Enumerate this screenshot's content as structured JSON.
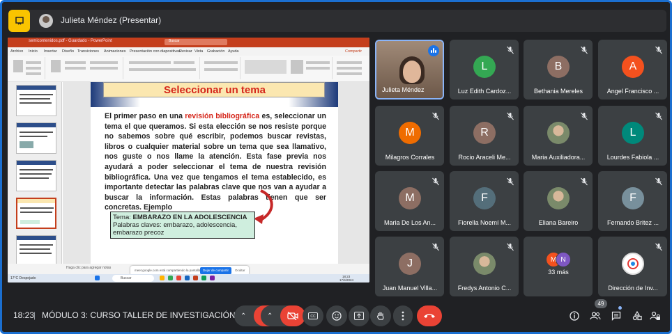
{
  "presenter": {
    "name": "Julieta Méndez (Presentar)"
  },
  "slide": {
    "title": "Seleccionar un tema",
    "body_pre": "El primer paso en una ",
    "body_highlight": "revisión bibliográfica",
    "body_post": " es, seleccionar un tema el que queramos. Si esta elección se nos resiste porque no sabemos sobre qué escribir, podemos buscar revistas, libros o cualquier material sobre un tema que sea llamativo, nos guste o nos llame la atención. Esta fase previa nos ayudará a poder seleccionar el tema de nuestra revisión bibliográfica. Una vez que tengamos el tema establecido, es importante detectar las palabras clave que nos van a ayudar a buscar la información. Estas palabras tienen que ser concretas. Ejemplo",
    "tema_label": "Tema: ",
    "tema_value": "EMBARAZO EN LA ADOLESCENCIA",
    "claves": "Palabras claves: embarazo, adolescencia, embarazo precoz"
  },
  "ppt": {
    "title_text": "semicontenidos.pdf - Guardado - PowerPoint",
    "search": "Buscar",
    "tabs": [
      "Archivo",
      "Inicio",
      "Insertar",
      "Diseño",
      "Transiciones",
      "Animaciones",
      "Presentación con diapositivas",
      "Revisar",
      "Vista",
      "Grabación",
      "Ayuda"
    ],
    "share": "Compartir",
    "notes_hint": "Haga clic para agregar notas",
    "share_msg": "meet.google.com está compartiendo la pantalla.",
    "stop_share": "Dejar de compartir",
    "hide": "Ocultar",
    "taskbar_search": "Buscar",
    "weather": "17°C Despejado",
    "time": "18:23",
    "date": "17/4/2024"
  },
  "participants": [
    {
      "name": "Julieta Méndez",
      "type": "video",
      "speaking": true
    },
    {
      "name": "Luz Edith Cardoz...",
      "initial": "L",
      "color": "#34a853",
      "muted": true
    },
    {
      "name": "Bethania Mereles",
      "initial": "B",
      "color": "#8d6e63",
      "muted": true
    },
    {
      "name": "Angel Francisco ...",
      "initial": "A",
      "color": "#f4511e",
      "muted": true
    },
    {
      "name": "Milagros Corrales",
      "initial": "M",
      "color": "#ef6c00",
      "muted": true
    },
    {
      "name": "Rocio Araceli Me...",
      "initial": "R",
      "color": "#8d6e63",
      "muted": true
    },
    {
      "name": "Maria Auxiliadora...",
      "type": "photo",
      "muted": true
    },
    {
      "name": "Lourdes Fabiola ...",
      "initial": "L",
      "color": "#00897b",
      "muted": true
    },
    {
      "name": "Maria De Los An...",
      "initial": "M",
      "color": "#8d6e63",
      "muted": true
    },
    {
      "name": "Fiorella Noemí M...",
      "initial": "F",
      "color": "#546e7a",
      "muted": true
    },
    {
      "name": "Eliana Bareiro",
      "type": "photo",
      "muted": true
    },
    {
      "name": "Fernando Britez ...",
      "initial": "F",
      "color": "#78909c",
      "muted": true
    },
    {
      "name": "Juan Manuel Villa...",
      "initial": "J",
      "color": "#8d6e63",
      "muted": true
    },
    {
      "name": "Fredys Antonio C...",
      "type": "photo",
      "muted": true
    },
    {
      "name": "33 más",
      "type": "more",
      "avatars": [
        "M",
        "N"
      ]
    },
    {
      "name": "Dirección de Inv...",
      "type": "logo",
      "muted": true
    }
  ],
  "bottom": {
    "time": "18:23",
    "separator": "|",
    "meeting": "MÓDULO 3: CURSO TALLER DE INVESTIGACIÓN",
    "participant_count": "49"
  },
  "colors": {
    "accent": "#1a73e8",
    "end_call": "#ea4335",
    "tile": "#3c4043",
    "bg": "#202124"
  }
}
